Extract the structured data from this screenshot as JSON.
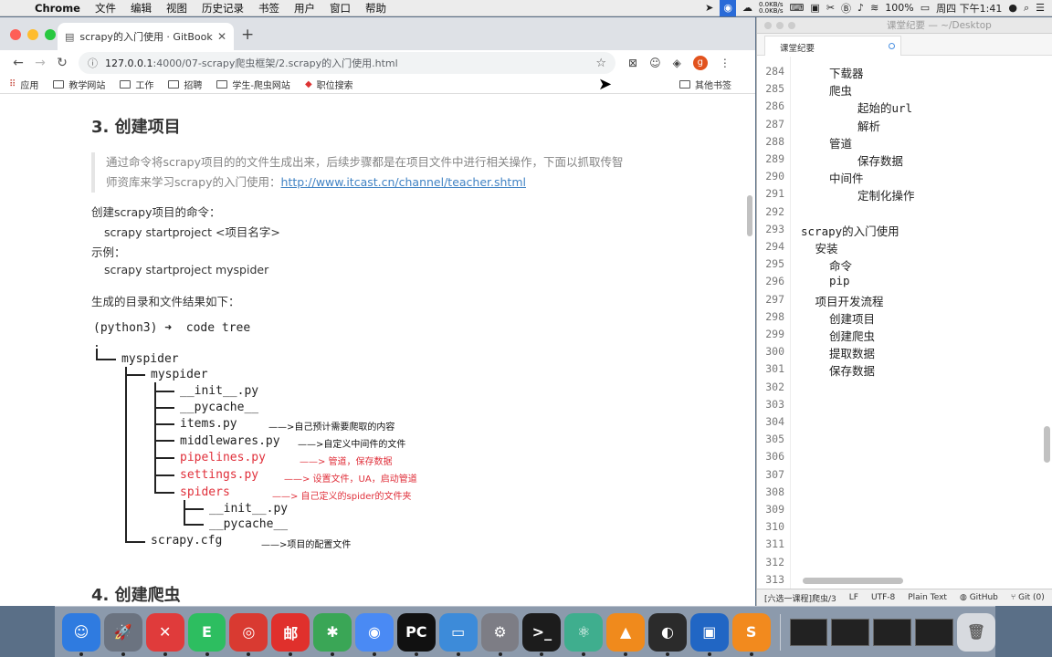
{
  "menubar": {
    "app": "Chrome",
    "items": [
      "文件",
      "编辑",
      "视图",
      "历史记录",
      "书签",
      "用户",
      "窗口",
      "帮助"
    ],
    "net_up": "0.0KB/s",
    "net_down": "0.0KB/s",
    "battery": "100%",
    "clock": "周四 下午1:41"
  },
  "browser": {
    "tab_title": "scrapy的入门使用 · GitBook",
    "url_host": "127.0.0.1",
    "url_path": ":4000/07-scrapy爬虫框架/2.scrapy的入门使用.html",
    "profile_initial": "g",
    "bookmarks": [
      "应用",
      "教学网站",
      "工作",
      "招聘",
      "学生-爬虫网站",
      "职位搜索"
    ],
    "other_bookmarks": "其他书签"
  },
  "doc": {
    "h3_create_project": "3. 创建项目",
    "quote_line1": "通过命令将scrapy项目的的文件生成出来，后续步骤都是在项目文件中进行相关操作，下面以抓取传智",
    "quote_line2": "师资库来学习scrapy的入门使用：",
    "quote_link": "http://www.itcast.cn/channel/teacher.shtml",
    "cmd_label": "创建scrapy项目的命令：",
    "cmd": "scrapy startproject <项目名字>",
    "example_label": "示例：",
    "example": "scrapy startproject myspider",
    "tree_intro": "生成的目录和文件结果如下：",
    "prompt": "(python3) ➜  code tree",
    "tree": {
      "dot": ".",
      "root": "myspider",
      "pkg": "myspider",
      "init": "__init__.py",
      "pycache": "__pycache__",
      "items": "items.py",
      "middlewares": "middlewares.py",
      "pipelines": "pipelines.py",
      "settings": "settings.py",
      "spiders": "spiders",
      "sp_init": "__init__.py",
      "sp_pycache": "__pycache__",
      "cfg": "scrapy.cfg"
    },
    "notes": {
      "items": "——>自己预计需要爬取的内容",
      "middlewares": "——>自定义中间件的文件",
      "pipelines": "——> 管道，保存数据",
      "settings": "——> 设置文件，UA，启动管道",
      "spiders": "——> 自己定义的spider的文件夹",
      "cfg": "——>项目的配置文件"
    },
    "h4_create_spider": "4. 创建爬虫"
  },
  "editor": {
    "window_title": "课堂纪要 — ~/Desktop",
    "tab": "课堂纪要",
    "lines": [
      {
        "n": "284",
        "indent": 2,
        "text": "下载器"
      },
      {
        "n": "285",
        "indent": 2,
        "text": "爬虫"
      },
      {
        "n": "286",
        "indent": 4,
        "text": "起始的url"
      },
      {
        "n": "287",
        "indent": 4,
        "text": "解析"
      },
      {
        "n": "288",
        "indent": 2,
        "text": "管道"
      },
      {
        "n": "289",
        "indent": 4,
        "text": "保存数据"
      },
      {
        "n": "290",
        "indent": 2,
        "text": "中间件"
      },
      {
        "n": "291",
        "indent": 4,
        "text": "定制化操作"
      },
      {
        "n": "292",
        "indent": 0,
        "text": ""
      },
      {
        "n": "293",
        "indent": 0,
        "text": "scrapy的入门使用"
      },
      {
        "n": "294",
        "indent": 1,
        "text": "安装"
      },
      {
        "n": "295",
        "indent": 2,
        "text": "命令"
      },
      {
        "n": "296",
        "indent": 2,
        "text": "pip"
      },
      {
        "n": "297",
        "indent": 1,
        "text": "项目开发流程"
      },
      {
        "n": "298",
        "indent": 2,
        "text": "创建项目"
      },
      {
        "n": "299",
        "indent": 2,
        "text": "创建爬虫"
      },
      {
        "n": "300",
        "indent": 2,
        "text": "提取数据"
      },
      {
        "n": "301",
        "indent": 2,
        "text": "保存数据"
      },
      {
        "n": "302",
        "indent": 0,
        "text": ""
      },
      {
        "n": "303",
        "indent": 0,
        "text": ""
      },
      {
        "n": "304",
        "indent": 0,
        "text": ""
      },
      {
        "n": "305",
        "indent": 0,
        "text": ""
      },
      {
        "n": "306",
        "indent": 0,
        "text": ""
      },
      {
        "n": "307",
        "indent": 0,
        "text": ""
      },
      {
        "n": "308",
        "indent": 0,
        "text": ""
      },
      {
        "n": "309",
        "indent": 0,
        "text": ""
      },
      {
        "n": "310",
        "indent": 0,
        "text": ""
      },
      {
        "n": "311",
        "indent": 0,
        "text": ""
      },
      {
        "n": "312",
        "indent": 0,
        "text": ""
      },
      {
        "n": "313",
        "indent": 0,
        "text": ""
      }
    ],
    "status": {
      "file": "[六选一课程]爬虫/3",
      "eol": "LF",
      "encoding": "UTF-8",
      "grammar": "Plain Text",
      "github": "GitHub",
      "git": "Git (0)"
    }
  },
  "dock": {
    "apps": [
      {
        "name": "finder",
        "color": "#2f7be0",
        "glyph": "☺"
      },
      {
        "name": "launchpad",
        "color": "#6b7380",
        "glyph": "🚀"
      },
      {
        "name": "xmind",
        "color": "#e03b3b",
        "glyph": "✕"
      },
      {
        "name": "evernote",
        "color": "#2dbe60",
        "glyph": "E"
      },
      {
        "name": "netease-music",
        "color": "#d93a31",
        "glyph": "◎"
      },
      {
        "name": "youdao-dict",
        "color": "#e0302c",
        "glyph": "邮"
      },
      {
        "name": "mindnode",
        "color": "#3aa656",
        "glyph": "✱"
      },
      {
        "name": "chrome",
        "color": "#4a8af4",
        "glyph": "◉"
      },
      {
        "name": "pycharm",
        "color": "#111111",
        "glyph": "PC"
      },
      {
        "name": "keynote",
        "color": "#3d8bd9",
        "glyph": "▭"
      },
      {
        "name": "system-preferences",
        "color": "#7d7d85",
        "glyph": "⚙"
      },
      {
        "name": "terminal",
        "color": "#1c1c1c",
        "glyph": ">_"
      },
      {
        "name": "atom",
        "color": "#3fae8e",
        "glyph": "⚛"
      },
      {
        "name": "vlc",
        "color": "#f08a1c",
        "glyph": "▲"
      },
      {
        "name": "obs",
        "color": "#2b2b2b",
        "glyph": "◐"
      },
      {
        "name": "virtualbox",
        "color": "#2166c4",
        "glyph": "▣"
      },
      {
        "name": "sublime-text",
        "color": "#f28a1e",
        "glyph": "S"
      }
    ]
  }
}
